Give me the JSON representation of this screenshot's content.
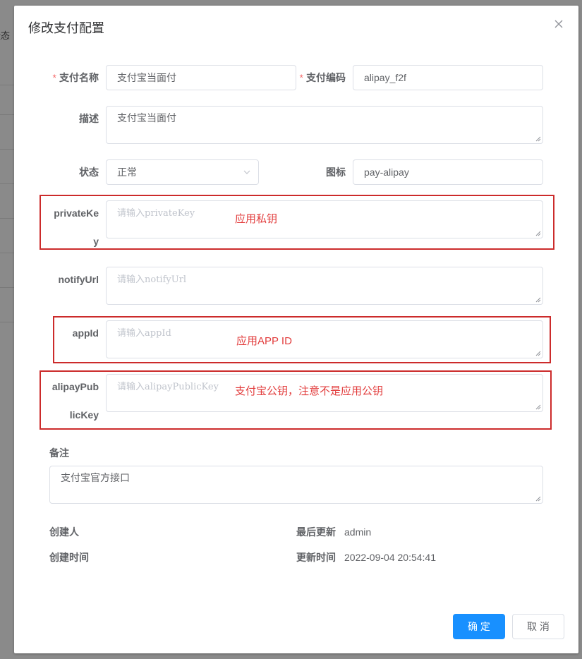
{
  "background": {
    "column_fragment": "状态"
  },
  "dialog": {
    "title": "修改支付配置",
    "close_icon": "close-icon"
  },
  "form": {
    "pay_name": {
      "label": "支付名称",
      "required": true,
      "value": "支付宝当面付"
    },
    "pay_code": {
      "label": "支付编码",
      "required": true,
      "value": "alipay_f2f"
    },
    "description": {
      "label": "描述",
      "value": "支付宝当面付"
    },
    "status": {
      "label": "状态",
      "value": "正常"
    },
    "icon": {
      "label": "图标",
      "value": "pay-alipay"
    },
    "private_key": {
      "label_line1": "privateKe",
      "label_line2": "y",
      "placeholder": "请输入privateKey"
    },
    "notify_url": {
      "label": "notifyUrl",
      "placeholder": "请输入notifyUrl"
    },
    "app_id": {
      "label": "appId",
      "placeholder": "请输入appId"
    },
    "alipay_public_key": {
      "label_line1": "alipayPub",
      "label_line2": "licKey",
      "placeholder": "请输入alipayPublicKey"
    },
    "remark": {
      "label": "备注",
      "value": "支付宝官方接口"
    }
  },
  "annotations": {
    "private_key": "应用私钥",
    "app_id": "应用APP ID",
    "public_key": "支付宝公钥，注意不是应用公钥",
    "color": "#cc2b2b"
  },
  "info": {
    "creator_label": "创建人",
    "creator_value": "",
    "last_updater_label": "最后更新",
    "last_updater_value": "admin",
    "created_time_label": "创建时间",
    "created_time_value": "",
    "updated_time_label": "更新时间",
    "updated_time_value": "2022-09-04 20:54:41"
  },
  "footer": {
    "confirm_label": "确 定",
    "cancel_label": "取 消"
  },
  "colors": {
    "primary": "#1890ff",
    "required_star": "#f56c6c",
    "annotation": "#e23c3c"
  }
}
